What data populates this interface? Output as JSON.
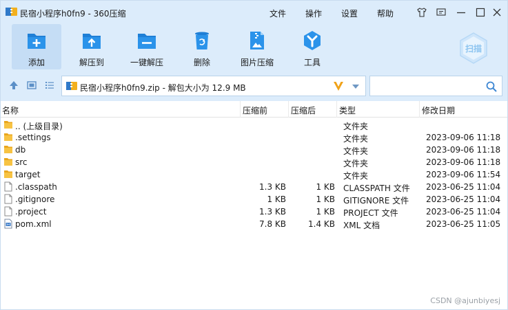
{
  "window": {
    "title": "民宿小程序h0fn9 - 360压缩",
    "menu": [
      "文件",
      "操作",
      "设置",
      "帮助"
    ]
  },
  "toolbar": {
    "items": [
      {
        "label": "添加",
        "icon": "add-icon",
        "active": true
      },
      {
        "label": "解压到",
        "icon": "extract-to-icon"
      },
      {
        "label": "一键解压",
        "icon": "one-click-extract-icon"
      },
      {
        "label": "删除",
        "icon": "trash-icon"
      },
      {
        "label": "图片压缩",
        "icon": "image-compress-icon"
      },
      {
        "label": "工具",
        "icon": "tools-icon"
      }
    ],
    "scan_label": "扫描"
  },
  "address": {
    "path": "民宿小程序h0fn9.zip - 解包大小为 12.9 MB",
    "search_placeholder": ""
  },
  "columns": {
    "name": "名称",
    "before": "压缩前",
    "after": "压缩后",
    "type": "类型",
    "date": "修改日期"
  },
  "rows": [
    {
      "name": ".. (上级目录)",
      "before": "",
      "after": "",
      "type": "文件夹",
      "date": "",
      "kind": "folder"
    },
    {
      "name": ".settings",
      "before": "",
      "after": "",
      "type": "文件夹",
      "date": "2023-09-06 11:18",
      "kind": "folder"
    },
    {
      "name": "db",
      "before": "",
      "after": "",
      "type": "文件夹",
      "date": "2023-09-06 11:18",
      "kind": "folder"
    },
    {
      "name": "src",
      "before": "",
      "after": "",
      "type": "文件夹",
      "date": "2023-09-06 11:18",
      "kind": "folder"
    },
    {
      "name": "target",
      "before": "",
      "after": "",
      "type": "文件夹",
      "date": "2023-09-06 11:54",
      "kind": "folder"
    },
    {
      "name": ".classpath",
      "before": "1.3 KB",
      "after": "1 KB",
      "type": "CLASSPATH 文件",
      "date": "2023-06-25 11:04",
      "kind": "file"
    },
    {
      "name": ".gitignore",
      "before": "1 KB",
      "after": "1 KB",
      "type": "GITIGNORE 文件",
      "date": "2023-06-25 11:04",
      "kind": "file"
    },
    {
      "name": ".project",
      "before": "1.3 KB",
      "after": "1 KB",
      "type": "PROJECT 文件",
      "date": "2023-06-25 11:04",
      "kind": "file"
    },
    {
      "name": "pom.xml",
      "before": "7.8 KB",
      "after": "1.4 KB",
      "type": "XML 文档",
      "date": "2023-06-25 11:05",
      "kind": "xml"
    }
  ],
  "watermark": "CSDN @ajunbiyesj"
}
